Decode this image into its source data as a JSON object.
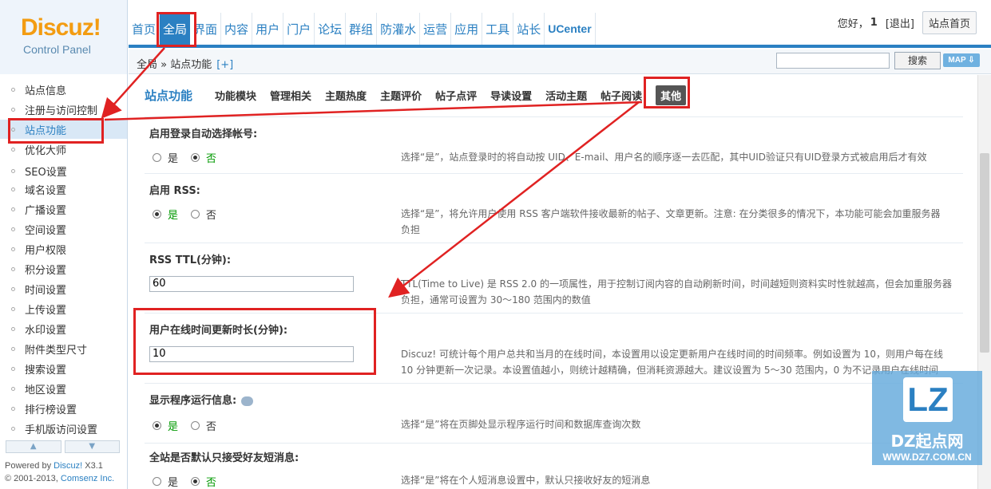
{
  "logo": {
    "brand": "Discuz!",
    "sub": "Control Panel"
  },
  "topnav": [
    {
      "label": "首页"
    },
    {
      "label": "全局"
    },
    {
      "label": "界面"
    },
    {
      "label": "内容"
    },
    {
      "label": "用户"
    },
    {
      "label": "门户"
    },
    {
      "label": "论坛"
    },
    {
      "label": "群组"
    },
    {
      "label": "防灌水"
    },
    {
      "label": "运营"
    },
    {
      "label": "应用"
    },
    {
      "label": "工具"
    },
    {
      "label": "站长"
    },
    {
      "label": "UCenter"
    }
  ],
  "user": {
    "greeting": "您好，",
    "name": "1",
    "logout": "[退出]",
    "home": "站点首页"
  },
  "crumb": {
    "path": "全局 » 站点功能",
    "plus": "[+]",
    "search_btn": "搜索",
    "map_btn": "MAP ⇩"
  },
  "sidebar": {
    "items": [
      {
        "label": "站点信息"
      },
      {
        "label": "注册与访问控制"
      },
      {
        "label": "站点功能"
      },
      {
        "label": "优化大师"
      },
      {
        "label": "SEO设置"
      },
      {
        "label": "域名设置"
      },
      {
        "label": "广播设置"
      },
      {
        "label": "空间设置"
      },
      {
        "label": "用户权限"
      },
      {
        "label": "积分设置"
      },
      {
        "label": "时间设置"
      },
      {
        "label": "上传设置"
      },
      {
        "label": "水印设置"
      },
      {
        "label": "附件类型尺寸"
      },
      {
        "label": "搜索设置"
      },
      {
        "label": "地区设置"
      },
      {
        "label": "排行榜设置"
      },
      {
        "label": "手机版访问设置"
      }
    ],
    "up": "▲",
    "down": "▼",
    "powered_prefix": "Powered by ",
    "powered_brand": "Discuz!",
    "powered_ver": " X3.1",
    "copyright_prefix": "© 2001-2013, ",
    "copyright_brand": "Comsenz Inc."
  },
  "tabs": {
    "title": "站点功能",
    "items": [
      {
        "label": "功能模块"
      },
      {
        "label": "管理相关"
      },
      {
        "label": "主题热度"
      },
      {
        "label": "主题评价"
      },
      {
        "label": "帖子点评"
      },
      {
        "label": "导读设置"
      },
      {
        "label": "活动主题"
      },
      {
        "label": "帖子阅读"
      },
      {
        "label": "其他"
      }
    ]
  },
  "rows": {
    "r1": {
      "title": "启用登录自动选择帐号:",
      "yes": "是",
      "no": "否",
      "desc": "选择“是”，站点登录时的将自动按 UID、E-mail、用户名的顺序逐一去匹配，其中UID验证只有UID登录方式被启用后才有效"
    },
    "r2": {
      "title": "启用 RSS:",
      "yes": "是",
      "no": "否",
      "desc1": "选择“是”，将允许用户使用 RSS 客户端软件接收最新的帖子、文章更新。注意: 在分类很多的情况下，本功能可能会加重服务器",
      "desc2": "负担"
    },
    "r3": {
      "title": "RSS TTL(分钟):",
      "value": "60",
      "desc1": "TTL(Time to Live) 是 RSS 2.0 的一项属性，用于控制订阅内容的自动刷新时间，时间越短则资料实时性就越高，但会加重服务器",
      "desc2": "负担，通常可设置为 30～180 范围内的数值"
    },
    "r4": {
      "title": "用户在线时间更新时长(分钟):",
      "value": "10",
      "desc1": "Discuz! 可统计每个用户总共和当月的在线时间，本设置用以设定更新用户在线时间的时间频率。例如设置为 10，则用户每在线",
      "desc2": "10 分钟更新一次记录。本设置值越小，则统计越精确，但消耗资源越大。建议设置为 5～30 范围内，0 为不记录用户在线时间"
    },
    "r5": {
      "title": "显示程序运行信息:",
      "yes": "是",
      "no": "否",
      "desc": "选择“是”将在页脚处显示程序运行时间和数据库查询次数"
    },
    "r6": {
      "title": "全站是否默认只接受好友短消息:",
      "yes": "是",
      "no": "否",
      "desc": "选择“是”将在个人短消息设置中，默认只接收好友的短消息"
    }
  },
  "watermark": {
    "logo": "LZ",
    "name": "DZ起点网",
    "url": "WWW.DZ7.COM.CN"
  },
  "colors": {
    "accent": "#2b80c2",
    "callout": "#e02222",
    "checked": "#009900"
  }
}
